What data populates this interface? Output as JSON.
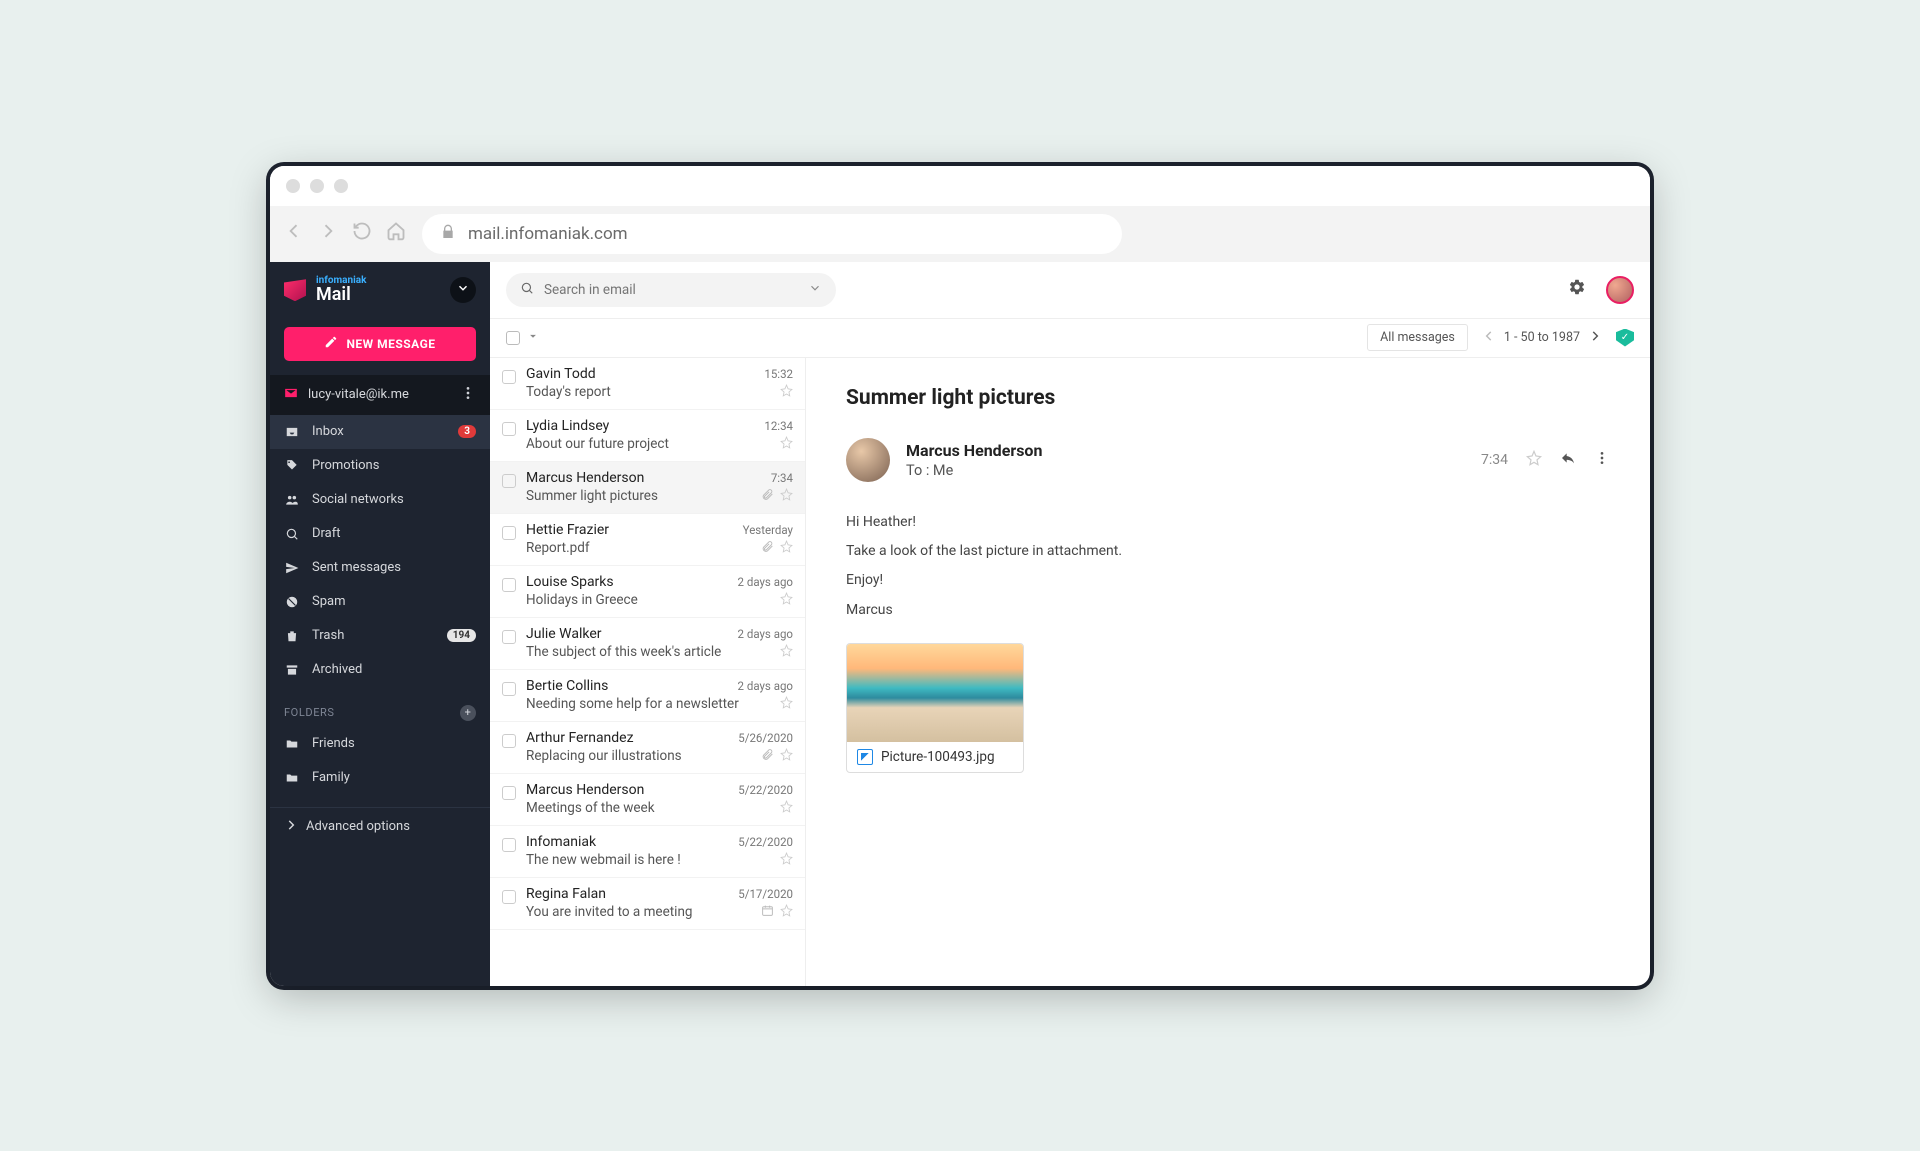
{
  "browser": {
    "url": "mail.infomaniak.com"
  },
  "brand": {
    "top": "infomaniak",
    "name": "Mail"
  },
  "compose_label": "NEW MESSAGE",
  "account": "lucy-vitale@ik.me",
  "nav": [
    {
      "label": "Inbox",
      "badge": "3",
      "badgeType": "red",
      "active": true,
      "icon": "inbox"
    },
    {
      "label": "Promotions",
      "icon": "tag"
    },
    {
      "label": "Social networks",
      "icon": "people"
    },
    {
      "label": "Draft",
      "icon": "draft"
    },
    {
      "label": "Sent messages",
      "icon": "send"
    },
    {
      "label": "Spam",
      "icon": "spam"
    },
    {
      "label": "Trash",
      "badge": "194",
      "badgeType": "gray",
      "icon": "trash"
    },
    {
      "label": "Archived",
      "icon": "archive"
    }
  ],
  "folders_header": "FOLDERS",
  "folders": [
    {
      "label": "Friends"
    },
    {
      "label": "Family"
    }
  ],
  "advanced": "Advanced options",
  "search": {
    "placeholder": "Search in email"
  },
  "controls": {
    "all": "All messages",
    "range": "1 - 50 to 1987"
  },
  "emails": [
    {
      "from": "Gavin Todd",
      "subject": "Today's report",
      "time": "15:32"
    },
    {
      "from": "Lydia Lindsey",
      "subject": "About our future project",
      "time": "12:34"
    },
    {
      "from": "Marcus Henderson",
      "subject": "Summer light pictures",
      "time": "7:34",
      "attachment": true,
      "selected": true
    },
    {
      "from": "Hettie Frazier",
      "subject": "Report.pdf",
      "time": "Yesterday",
      "attachment": true
    },
    {
      "from": "Louise Sparks",
      "subject": "Holidays in Greece",
      "time": "2 days ago"
    },
    {
      "from": "Julie Walker",
      "subject": "The subject of this week's article",
      "time": "2 days ago"
    },
    {
      "from": "Bertie Collins",
      "subject": "Needing some help for a newsletter",
      "time": "2 days ago"
    },
    {
      "from": "Arthur Fernandez",
      "subject": "Replacing our illustrations",
      "time": "5/26/2020",
      "attachment": true
    },
    {
      "from": "Marcus Henderson",
      "subject": "Meetings of the week",
      "time": "5/22/2020"
    },
    {
      "from": "Infomaniak",
      "subject": "The new webmail is here !",
      "time": "5/22/2020"
    },
    {
      "from": "Regina Falan",
      "subject": "You are invited to a meeting",
      "time": "5/17/2020",
      "calendar": true
    }
  ],
  "reader": {
    "subject": "Summer light pictures",
    "from": "Marcus Henderson",
    "to": "To : Me",
    "time": "7:34",
    "body": [
      "Hi Heather!",
      "Take a look of the last picture in attachment.",
      "Enjoy!",
      "Marcus"
    ],
    "attachment": "Picture-100493.jpg"
  }
}
